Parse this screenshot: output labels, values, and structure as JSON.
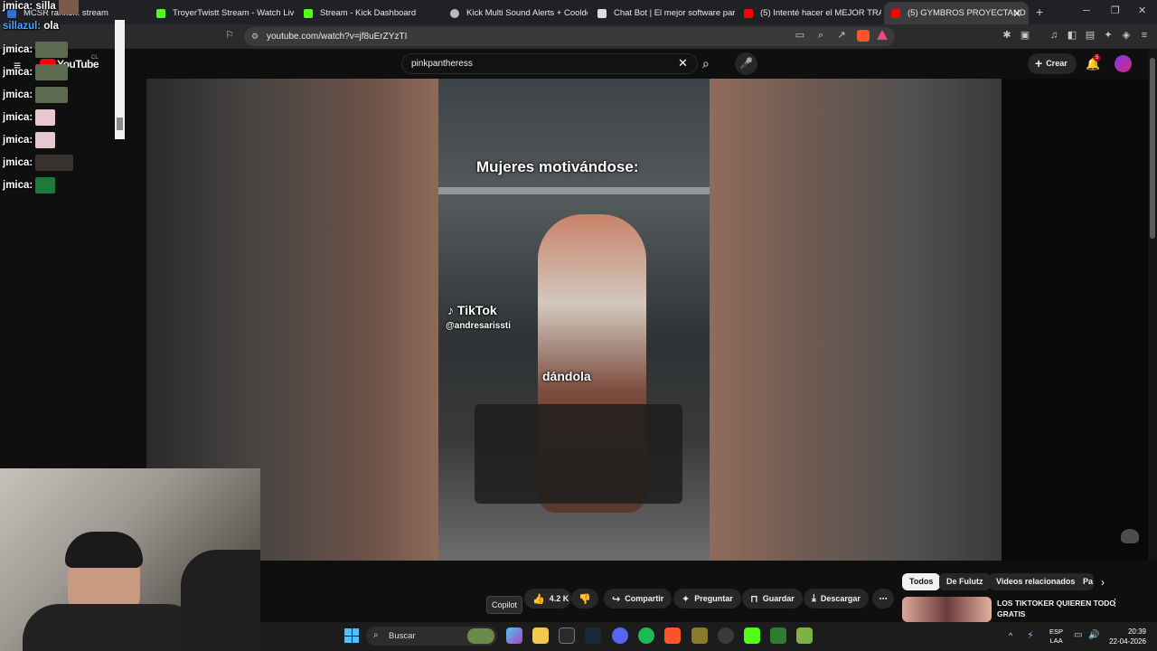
{
  "tabs": [
    {
      "title": "MCSR ranke... stream",
      "color": "#2f6fd6"
    },
    {
      "title": "TroyerTwistt Stream - Watch Live on",
      "color": "#53fc18"
    },
    {
      "title": "Stream - Kick Dashboard",
      "color": "#53fc18"
    },
    {
      "title": "Kick Multi Sound Alerts + Cooldown",
      "color": "#bbbbbb"
    },
    {
      "title": "Chat Bot | El mejor software para po",
      "color": "#dddddd"
    },
    {
      "title": "(5) Intenté hacer el MEJOR TRAGO e",
      "color": "#ff0000"
    },
    {
      "title": "(5) GYMBROS PROYECTAND",
      "color": "#ff0000"
    }
  ],
  "browser": {
    "url": "youtube.com/watch?v=jf8uErZYzTI",
    "new_tab": "+"
  },
  "youtube": {
    "logo": "YouTube",
    "region": "CL",
    "search_value": "pinkpantheress",
    "create_label": "Crear",
    "notif_count": "5"
  },
  "video": {
    "caption_top": "Mujeres motivándose:",
    "tiktok": "TikTok",
    "handle": "@andresarissti",
    "caption_mid": "dándola"
  },
  "chat": [
    {
      "user": "jmica:",
      "msg": "silla",
      "ucolor": "#ffffff"
    },
    {
      "user": "sillazul:",
      "msg": "ola",
      "ucolor": "#4aa3ff"
    },
    {
      "user": "jmica:",
      "msg": "",
      "ucolor": "#ffffff"
    },
    {
      "user": "jmica:",
      "msg": "",
      "ucolor": "#ffffff"
    },
    {
      "user": "jmica:",
      "msg": "",
      "ucolor": "#ffffff"
    },
    {
      "user": "jmica:",
      "msg": "",
      "ucolor": "#ffffff"
    },
    {
      "user": "jmica:",
      "msg": "",
      "ucolor": "#ffffff"
    },
    {
      "user": "jmica:",
      "msg": "",
      "ucolor": "#ffffff"
    },
    {
      "user": "jmica:",
      "msg": "",
      "ucolor": "#ffffff"
    }
  ],
  "actions": {
    "likes": "4.2 K",
    "share": "Compartir",
    "ask": "Preguntar",
    "save": "Guardar",
    "download": "Descargar",
    "tooltip": "Copilot"
  },
  "chips": [
    "Todos",
    "De Fulutz",
    "Videos relacionados",
    "Pa"
  ],
  "related": {
    "title_line1": "LOS TIKTOKER QUIEREN TODO",
    "title_line2": "GRATIS"
  },
  "taskbar": {
    "search": "Buscar",
    "lang1": "ESP",
    "lang2": "LAA",
    "time": "20:39",
    "date": "22-04-2026"
  }
}
